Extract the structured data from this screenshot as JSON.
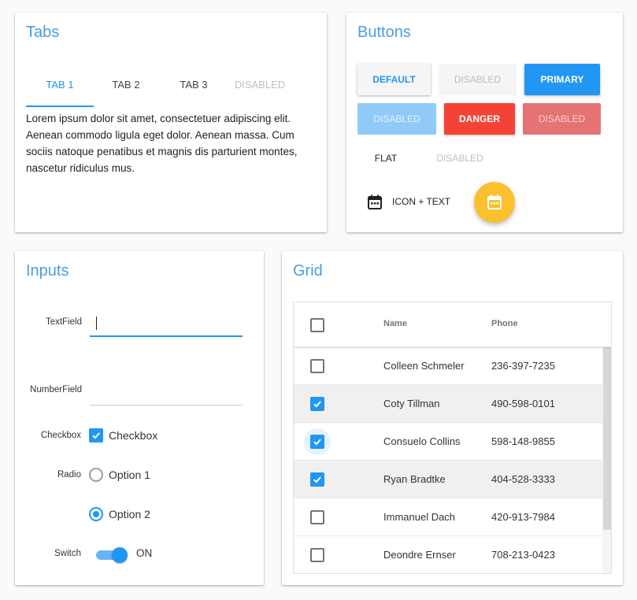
{
  "tabs_card": {
    "title": "Tabs",
    "tabs": [
      {
        "label": "TAB 1",
        "state": "active"
      },
      {
        "label": "TAB 2",
        "state": "normal"
      },
      {
        "label": "TAB 3",
        "state": "normal"
      },
      {
        "label": "DISABLED",
        "state": "disabled"
      }
    ],
    "content": "Lorem ipsum dolor sit amet, consectetuer adipiscing elit. Aenean commodo ligula eget dolor. Aenean massa. Cum sociis natoque penatibus et magnis dis parturient montes, nascetur ridiculus mus."
  },
  "buttons_card": {
    "title": "Buttons",
    "default": "DEFAULT",
    "disabled": "DISABLED",
    "primary": "PRIMARY",
    "danger": "DANGER",
    "flat": "FLAT",
    "icon_text": "ICON + TEXT",
    "icons": {
      "icon_button": "calendar-icon",
      "fab": "calendar-icon"
    },
    "colors": {
      "primary": "#2196f3",
      "danger": "#f44336",
      "fab": "#fbc02d"
    }
  },
  "inputs_card": {
    "title": "Inputs",
    "textfield_label": "TextField",
    "textfield_value": "",
    "numberfield_label": "NumberField",
    "numberfield_value": "",
    "checkbox_label": "Checkbox",
    "checkbox_text": "Checkbox",
    "checkbox_checked": true,
    "radio_label": "Radio",
    "radio_options": [
      "Option 1",
      "Option 2"
    ],
    "radio_selected": "Option 2",
    "switch_label": "Switch",
    "switch_state": "ON"
  },
  "grid_card": {
    "title": "Grid",
    "columns": [
      "Name",
      "Phone"
    ],
    "rows": [
      {
        "name": "Colleen Schmeler",
        "phone": "236-397-7235",
        "checked": false
      },
      {
        "name": "Coty Tillman",
        "phone": "490-598-0101",
        "checked": true
      },
      {
        "name": "Consuelo Collins",
        "phone": "598-148-9855",
        "checked": true
      },
      {
        "name": "Ryan Bradtke",
        "phone": "404-528-3333",
        "checked": true
      },
      {
        "name": "Immanuel Dach",
        "phone": "420-913-7984",
        "checked": false
      },
      {
        "name": "Deondre Ernser",
        "phone": "708-213-0423",
        "checked": false
      }
    ]
  }
}
